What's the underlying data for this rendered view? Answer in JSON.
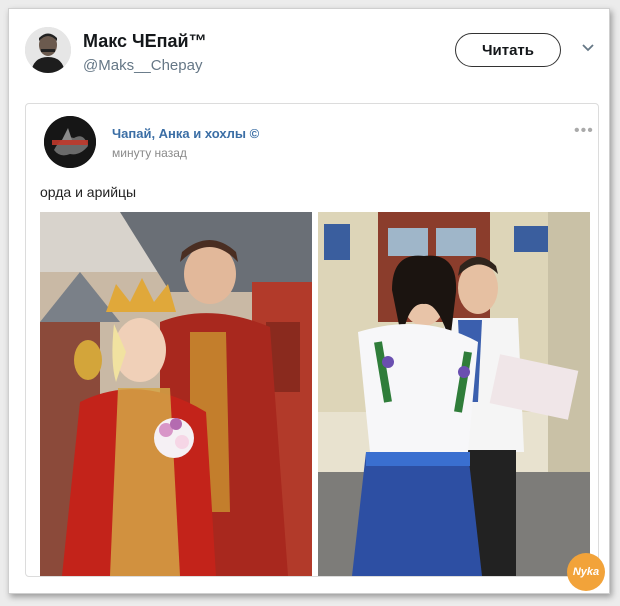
{
  "tweet": {
    "author_name": "Макс ЧЕпай™",
    "author_handle": "@Maks__Chepay",
    "follow_label": "Читать"
  },
  "quoted": {
    "name": "Чапай, Анка и хохлы ©",
    "time": "минуту назад",
    "more": "•••",
    "text": "орда и арийцы"
  },
  "watermark_text": "Nyka",
  "icons": {
    "chevron": "chevron-down-icon",
    "more": "more-icon"
  }
}
